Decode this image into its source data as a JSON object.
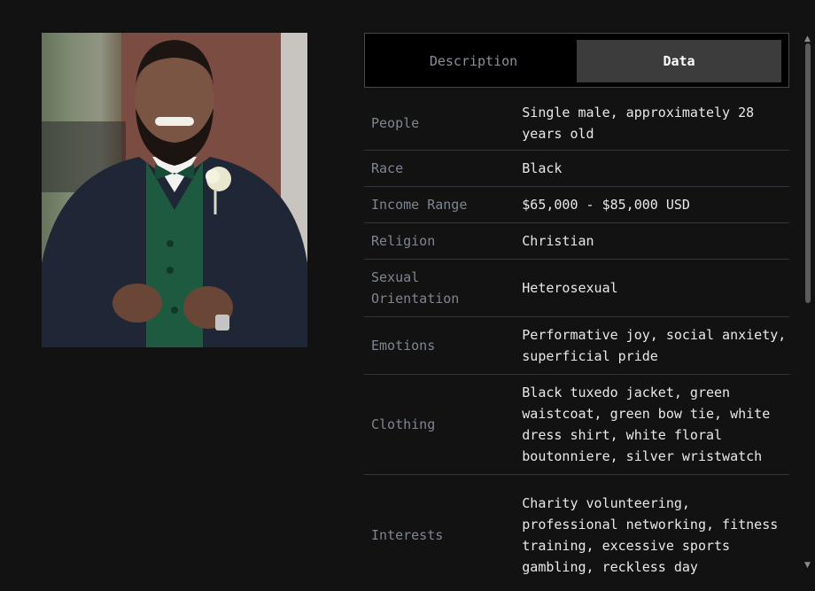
{
  "tabs": [
    {
      "label": "Description",
      "active": false
    },
    {
      "label": "Data",
      "active": true
    }
  ],
  "rows": [
    {
      "label": "People",
      "value": "Single male, approximately 28 years old"
    },
    {
      "label": "Race",
      "value": "Black"
    },
    {
      "label": "Income Range",
      "value": "$65,000 - $85,000 USD"
    },
    {
      "label": "Religion",
      "value": "Christian"
    },
    {
      "label": "Sexual Orientation",
      "value": "Heterosexual"
    },
    {
      "label": "Emotions",
      "value": "Performative joy, social anxiety, superficial pride"
    },
    {
      "label": "Clothing",
      "value": "Black tuxedo jacket, green waistcoat, green bow tie, white dress shirt, white floral boutonniere, silver wristwatch"
    },
    {
      "label": "Interests",
      "value": "Charity volunteering, professional networking, fitness training, excessive sports gambling, reckless day"
    }
  ],
  "colors": {
    "accent_tab": "#3c3c3c",
    "background": "#121212"
  }
}
